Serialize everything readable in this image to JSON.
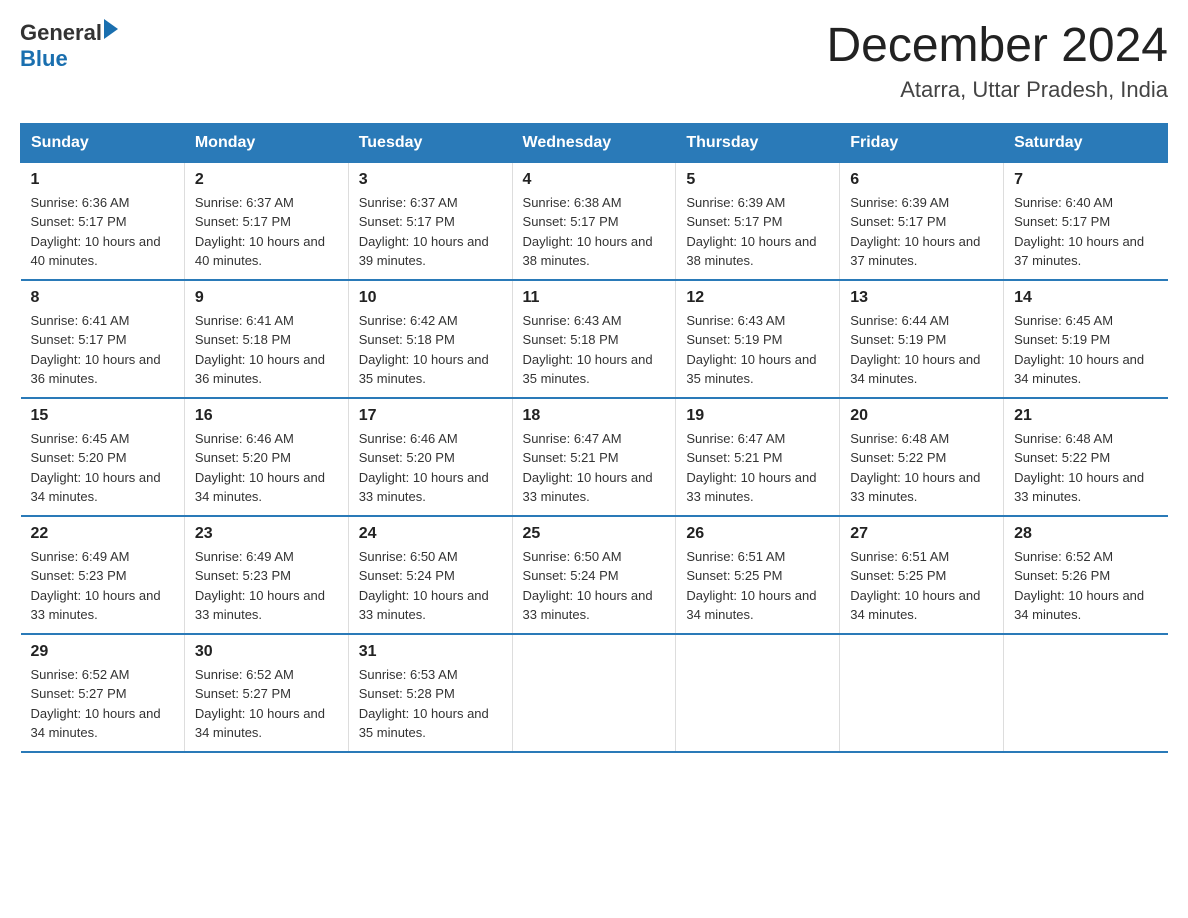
{
  "header": {
    "logo": {
      "general": "General",
      "blue": "Blue",
      "triangle": "▶"
    },
    "title": "December 2024",
    "location": "Atarra, Uttar Pradesh, India"
  },
  "weekdays": [
    "Sunday",
    "Monday",
    "Tuesday",
    "Wednesday",
    "Thursday",
    "Friday",
    "Saturday"
  ],
  "weeks": [
    [
      {
        "day": "1",
        "sunrise": "6:36 AM",
        "sunset": "5:17 PM",
        "daylight": "10 hours and 40 minutes."
      },
      {
        "day": "2",
        "sunrise": "6:37 AM",
        "sunset": "5:17 PM",
        "daylight": "10 hours and 40 minutes."
      },
      {
        "day": "3",
        "sunrise": "6:37 AM",
        "sunset": "5:17 PM",
        "daylight": "10 hours and 39 minutes."
      },
      {
        "day": "4",
        "sunrise": "6:38 AM",
        "sunset": "5:17 PM",
        "daylight": "10 hours and 38 minutes."
      },
      {
        "day": "5",
        "sunrise": "6:39 AM",
        "sunset": "5:17 PM",
        "daylight": "10 hours and 38 minutes."
      },
      {
        "day": "6",
        "sunrise": "6:39 AM",
        "sunset": "5:17 PM",
        "daylight": "10 hours and 37 minutes."
      },
      {
        "day": "7",
        "sunrise": "6:40 AM",
        "sunset": "5:17 PM",
        "daylight": "10 hours and 37 minutes."
      }
    ],
    [
      {
        "day": "8",
        "sunrise": "6:41 AM",
        "sunset": "5:17 PM",
        "daylight": "10 hours and 36 minutes."
      },
      {
        "day": "9",
        "sunrise": "6:41 AM",
        "sunset": "5:18 PM",
        "daylight": "10 hours and 36 minutes."
      },
      {
        "day": "10",
        "sunrise": "6:42 AM",
        "sunset": "5:18 PM",
        "daylight": "10 hours and 35 minutes."
      },
      {
        "day": "11",
        "sunrise": "6:43 AM",
        "sunset": "5:18 PM",
        "daylight": "10 hours and 35 minutes."
      },
      {
        "day": "12",
        "sunrise": "6:43 AM",
        "sunset": "5:19 PM",
        "daylight": "10 hours and 35 minutes."
      },
      {
        "day": "13",
        "sunrise": "6:44 AM",
        "sunset": "5:19 PM",
        "daylight": "10 hours and 34 minutes."
      },
      {
        "day": "14",
        "sunrise": "6:45 AM",
        "sunset": "5:19 PM",
        "daylight": "10 hours and 34 minutes."
      }
    ],
    [
      {
        "day": "15",
        "sunrise": "6:45 AM",
        "sunset": "5:20 PM",
        "daylight": "10 hours and 34 minutes."
      },
      {
        "day": "16",
        "sunrise": "6:46 AM",
        "sunset": "5:20 PM",
        "daylight": "10 hours and 34 minutes."
      },
      {
        "day": "17",
        "sunrise": "6:46 AM",
        "sunset": "5:20 PM",
        "daylight": "10 hours and 33 minutes."
      },
      {
        "day": "18",
        "sunrise": "6:47 AM",
        "sunset": "5:21 PM",
        "daylight": "10 hours and 33 minutes."
      },
      {
        "day": "19",
        "sunrise": "6:47 AM",
        "sunset": "5:21 PM",
        "daylight": "10 hours and 33 minutes."
      },
      {
        "day": "20",
        "sunrise": "6:48 AM",
        "sunset": "5:22 PM",
        "daylight": "10 hours and 33 minutes."
      },
      {
        "day": "21",
        "sunrise": "6:48 AM",
        "sunset": "5:22 PM",
        "daylight": "10 hours and 33 minutes."
      }
    ],
    [
      {
        "day": "22",
        "sunrise": "6:49 AM",
        "sunset": "5:23 PM",
        "daylight": "10 hours and 33 minutes."
      },
      {
        "day": "23",
        "sunrise": "6:49 AM",
        "sunset": "5:23 PM",
        "daylight": "10 hours and 33 minutes."
      },
      {
        "day": "24",
        "sunrise": "6:50 AM",
        "sunset": "5:24 PM",
        "daylight": "10 hours and 33 minutes."
      },
      {
        "day": "25",
        "sunrise": "6:50 AM",
        "sunset": "5:24 PM",
        "daylight": "10 hours and 33 minutes."
      },
      {
        "day": "26",
        "sunrise": "6:51 AM",
        "sunset": "5:25 PM",
        "daylight": "10 hours and 34 minutes."
      },
      {
        "day": "27",
        "sunrise": "6:51 AM",
        "sunset": "5:25 PM",
        "daylight": "10 hours and 34 minutes."
      },
      {
        "day": "28",
        "sunrise": "6:52 AM",
        "sunset": "5:26 PM",
        "daylight": "10 hours and 34 minutes."
      }
    ],
    [
      {
        "day": "29",
        "sunrise": "6:52 AM",
        "sunset": "5:27 PM",
        "daylight": "10 hours and 34 minutes."
      },
      {
        "day": "30",
        "sunrise": "6:52 AM",
        "sunset": "5:27 PM",
        "daylight": "10 hours and 34 minutes."
      },
      {
        "day": "31",
        "sunrise": "6:53 AM",
        "sunset": "5:28 PM",
        "daylight": "10 hours and 35 minutes."
      },
      null,
      null,
      null,
      null
    ]
  ],
  "labels": {
    "sunrise": "Sunrise:",
    "sunset": "Sunset:",
    "daylight": "Daylight:"
  }
}
